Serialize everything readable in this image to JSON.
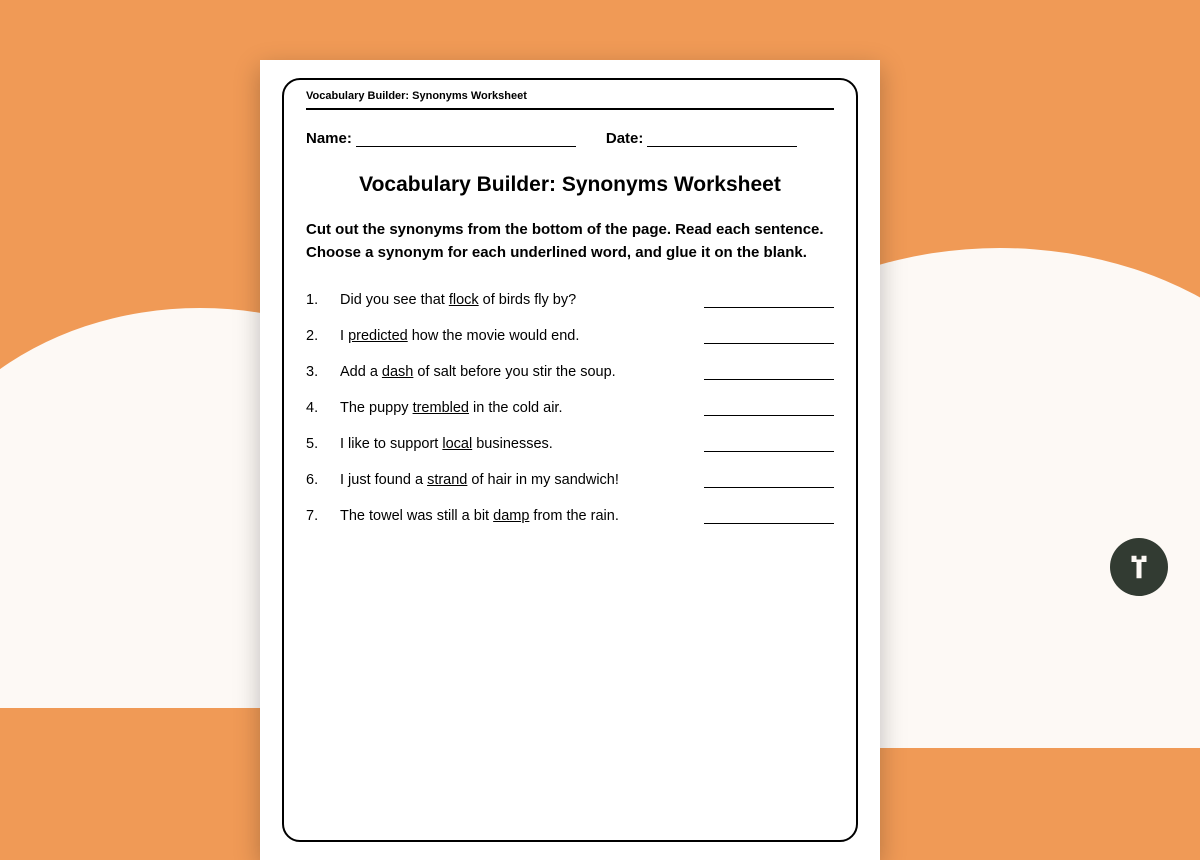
{
  "header_label": "Vocabulary Builder: Synonyms Worksheet",
  "name_label": "Name:",
  "date_label": "Date:",
  "title": "Vocabulary Builder: Synonyms Worksheet",
  "instructions": "Cut out the synonyms from the bottom of the page. Read each sentence. Choose a synonym for each underlined word, and glue it on the blank.",
  "items": [
    {
      "num": "1.",
      "pre": "Did you see that ",
      "u": "flock",
      "post": " of birds fly by?"
    },
    {
      "num": "2.",
      "pre": "I ",
      "u": "predicted",
      "post": " how the movie would end."
    },
    {
      "num": "3.",
      "pre": "Add a ",
      "u": "dash",
      "post": " of salt before you stir the soup."
    },
    {
      "num": "4.",
      "pre": "The puppy ",
      "u": "trembled",
      "post": " in the cold air."
    },
    {
      "num": "5.",
      "pre": "I like to support ",
      "u": "local",
      "post": " businesses."
    },
    {
      "num": "6.",
      "pre": "I just found a ",
      "u": "strand",
      "post": " of hair in my sandwich!"
    },
    {
      "num": "7.",
      "pre": "The towel was still a bit ",
      "u": "damp",
      "post": " from the rain."
    }
  ]
}
